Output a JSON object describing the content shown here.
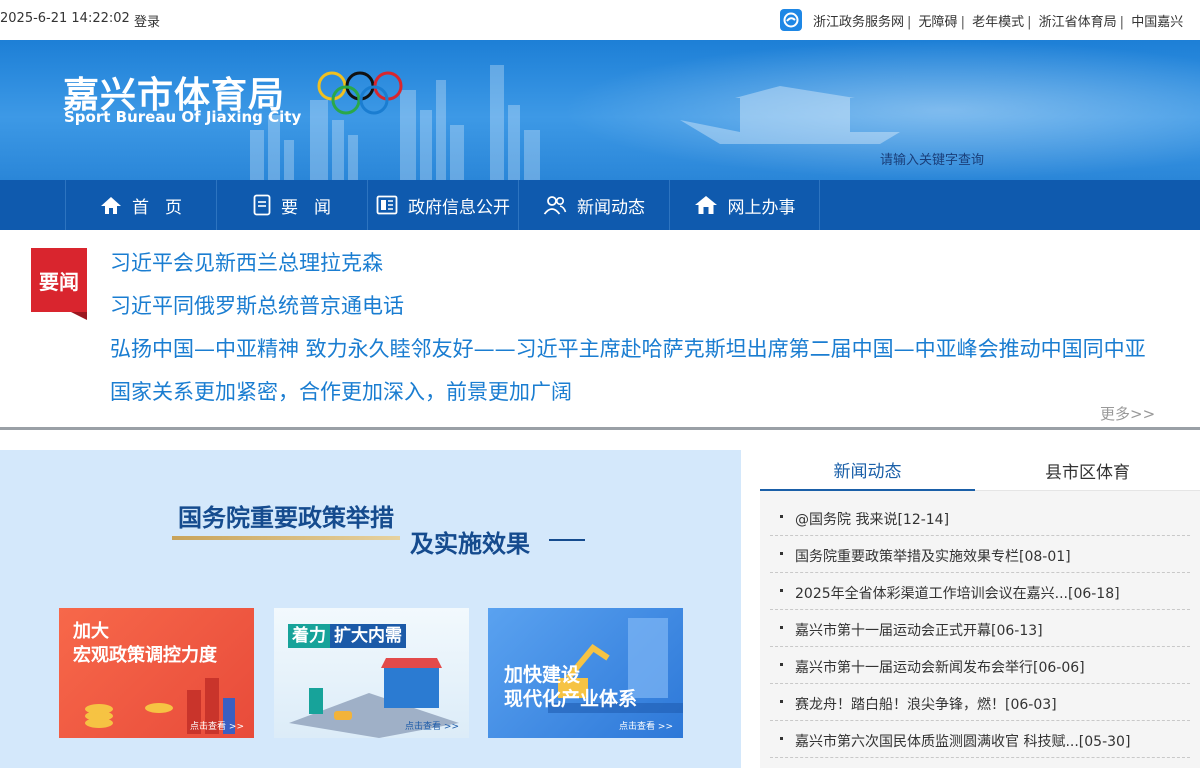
{
  "topbar": {
    "datetime": "2025-6-21 14:22:02",
    "login": "登录",
    "links": [
      "浙江政务服务网",
      "无障碍",
      "老年模式",
      "浙江省体育局",
      "中国嘉兴"
    ]
  },
  "banner": {
    "title": "嘉兴市体育局",
    "subtitle": "Sport Bureau Of Jiaxing City",
    "search_hint": "请输入关键字查询"
  },
  "nav": {
    "items": [
      {
        "label": "首页",
        "icon": "home-icon"
      },
      {
        "label": "要闻",
        "icon": "document-icon"
      },
      {
        "label": "政府信息公开",
        "icon": "info-panel-icon"
      },
      {
        "label": "新闻动态",
        "icon": "people-icon"
      },
      {
        "label": "网上办事",
        "icon": "house-icon"
      }
    ]
  },
  "headlines": {
    "badge": "要闻",
    "lines": [
      "习近平会见新西兰总理拉克森",
      "习近平同俄罗斯总统普京通电话",
      "弘扬中国—中亚精神 致力永久睦邻友好——习近平主席赴哈萨克斯坦出席第二届中国—中亚峰会推动中国同中亚",
      "国家关系更加紧密，合作更加深入，前景更加广阔"
    ],
    "more": "更多>>"
  },
  "policy": {
    "title_part1": "国务院重要政策举措",
    "title_part2": "及实施效果",
    "cards": [
      {
        "line1": "加大",
        "line2": "宏观政策调控力度",
        "cta": "点击查看 >>"
      },
      {
        "line1": "着力",
        "line2": "扩大内需",
        "cta": "点击查看 >>"
      },
      {
        "line1": "加快建设",
        "line2": "现代化产业体系",
        "cta": "点击查看 >>"
      }
    ]
  },
  "news": {
    "tabs": [
      "新闻动态",
      "县市区体育"
    ],
    "items": [
      "@国务院 我来说[12-14]",
      "国务院重要政策举措及实施效果专栏[08-01]",
      "2025年全省体彩渠道工作培训会议在嘉兴...[06-18]",
      "嘉兴市第十一届运动会正式开幕[06-13]",
      "嘉兴市第十一届运动会新闻发布会举行[06-06]",
      "赛龙舟！踏白船！浪尖争锋，燃！[06-03]",
      "嘉兴市第六次国民体质监测圆满收官 科技赋...[05-30]"
    ]
  },
  "colors": {
    "nav_bg": "#0f5aae",
    "headline_link": "#1a7dd1",
    "badge_red": "#d9252e",
    "policy_bg": "#d4e8fb"
  }
}
